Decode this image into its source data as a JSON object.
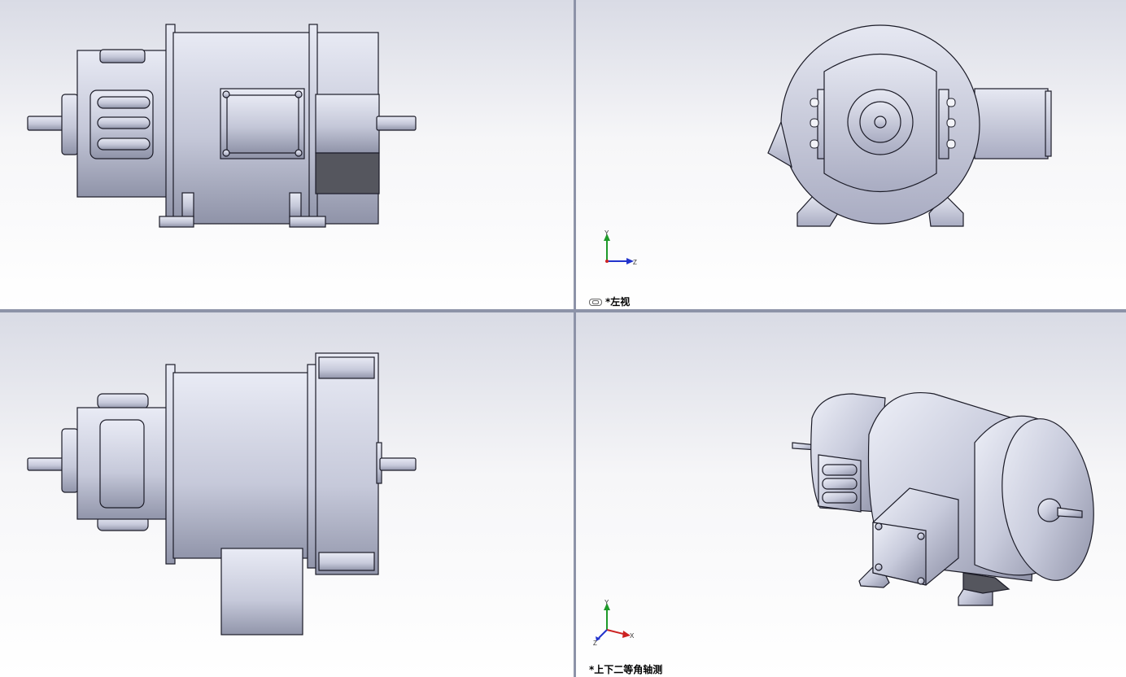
{
  "viewports": {
    "top_left": {
      "label": ""
    },
    "top_right": {
      "label": "*左视"
    },
    "bottom_left": {
      "label": ""
    },
    "bottom_right": {
      "label": "*上下二等角轴测"
    }
  },
  "triad": {
    "x": "X",
    "y": "Y",
    "z": "Z"
  },
  "colors": {
    "part": "#c9cddd",
    "edge": "#1c1c28",
    "dark": "#55565e",
    "separator": "#8d93a8"
  }
}
